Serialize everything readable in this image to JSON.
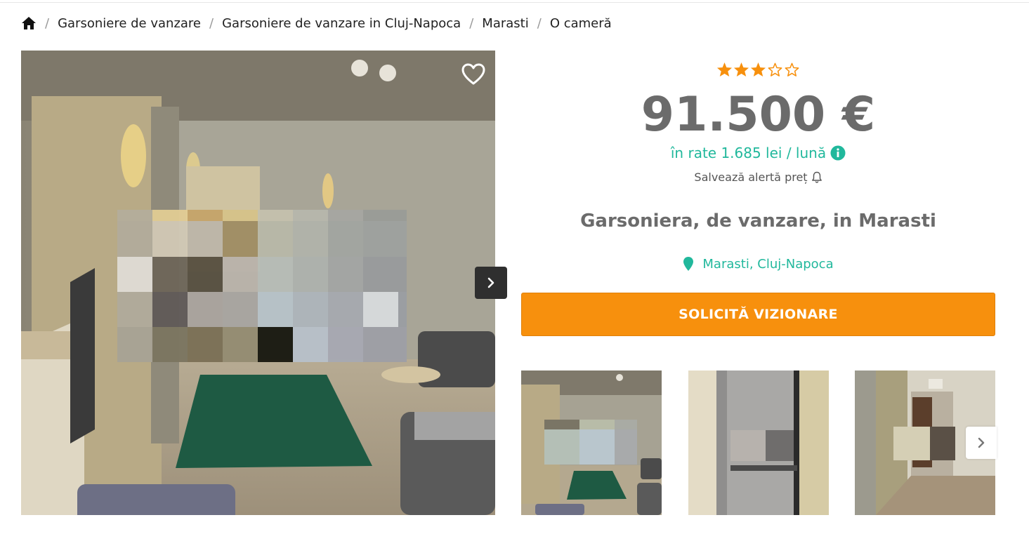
{
  "breadcrumb": {
    "home_icon": "home-icon",
    "items": [
      "Garsoniere de vanzare",
      "Garsoniere de vanzare in Cluj-Napoca",
      "Marasti",
      "O cameră"
    ]
  },
  "gallery": {
    "favorite_icon": "heart-outline-icon",
    "next_icon": "chevron-right-icon"
  },
  "listing": {
    "rating": 3,
    "rating_max": 5,
    "price": "91.500 €",
    "installment": "în rate 1.685 lei / lună",
    "price_alert": "Salvează alertă preț",
    "title": "Garsoniera, de vanzare, in Marasti",
    "location": "Marasti, Cluj-Napoca",
    "cta_label": "SOLICITĂ VIZIONARE"
  },
  "colors": {
    "accent_teal": "#21b89c",
    "cta_orange": "#f7900d",
    "star_orange": "#f7900d",
    "price_gray": "#6b6b6b"
  }
}
